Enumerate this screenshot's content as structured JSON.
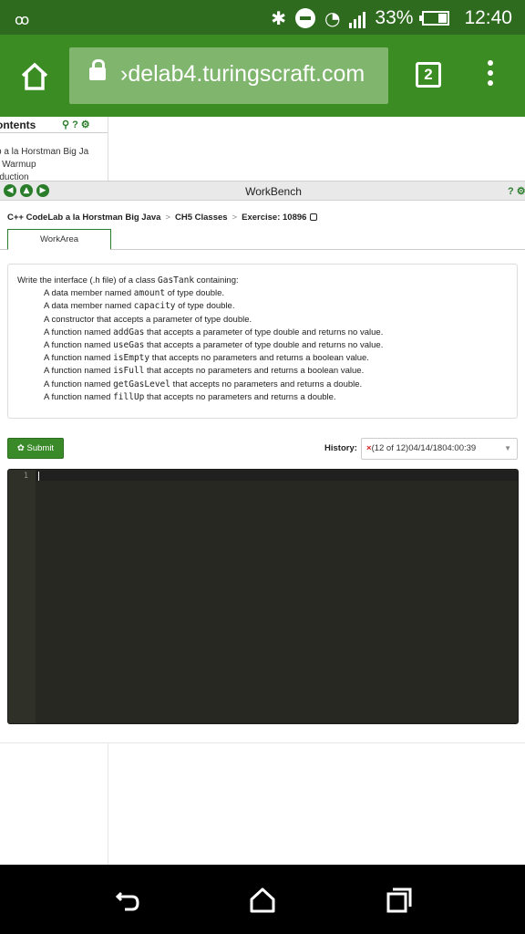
{
  "status_bar": {
    "voicemail_icon": "voicemail-icon",
    "battery_percent": "33%",
    "battery_level": 0.33,
    "time": "12:40"
  },
  "browser": {
    "url": "›delab4.turingscraft.com",
    "tab_count": "2"
  },
  "toc": {
    "title": "ontents",
    "items": [
      "b a la Horstman Big Ja",
      "› Warmup",
      "›duction"
    ]
  },
  "workbench": {
    "title": "WorkBench",
    "help": "? ⚙"
  },
  "breadcrumb": {
    "items": [
      "C++ CodeLab a la Horstman Big Java",
      "CH5 Classes",
      "Exercise: 10896"
    ],
    "separator": ">"
  },
  "tabs": {
    "workarea": "WorkArea"
  },
  "instructions": {
    "intro_prefix": "Write the interface (.h file) of a class ",
    "intro_code": "GasTank",
    "intro_suffix": " containing:",
    "lines": [
      {
        "pre": "A data member named ",
        "code": "amount",
        "post": " of type double."
      },
      {
        "pre": "A data member named ",
        "code": "capacity",
        "post": " of type double."
      },
      {
        "pre": "A constructor that accepts a parameter of type double.",
        "code": "",
        "post": ""
      },
      {
        "pre": "A function named ",
        "code": "addGas",
        "post": " that accepts a parameter of type double and returns no value."
      },
      {
        "pre": "A function named ",
        "code": "useGas",
        "post": " that accepts a parameter of type double and returns no value."
      },
      {
        "pre": "A function named ",
        "code": "isEmpty",
        "post": " that accepts no parameters and returns a boolean value."
      },
      {
        "pre": "A function named ",
        "code": "isFull",
        "post": " that accepts no parameters and returns a boolean value."
      },
      {
        "pre": "A function named ",
        "code": "getGasLevel",
        "post": " that accepts no parameters and returns a double."
      },
      {
        "pre": "A function named ",
        "code": "fillUp",
        "post": " that accepts no parameters and returns a double."
      }
    ]
  },
  "submit": {
    "label": "✿ Submit"
  },
  "history": {
    "label": "History:",
    "status_icon": "×",
    "selected": "(12 of 12)04/14/1804:00:39",
    "caret": "▼"
  },
  "editor": {
    "line_number": "1",
    "content": ""
  }
}
